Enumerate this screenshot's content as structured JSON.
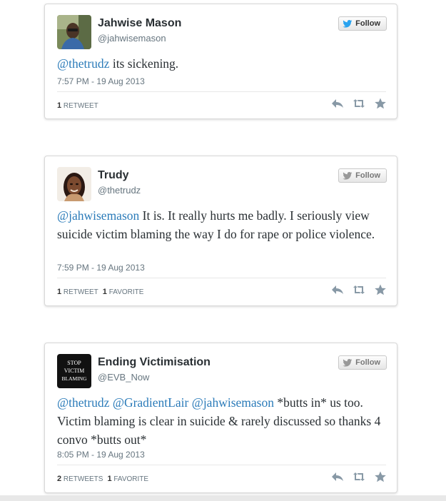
{
  "follow_label": "Follow",
  "tweets": [
    {
      "name": "Jahwise Mason",
      "handle": "@jahwisemason",
      "mention1": "@thetrudz",
      "mention2": "",
      "mention3": "",
      "body": "its sickening.",
      "timestamp": "7:57 PM - 19 Aug 2013",
      "retweet_count": "1",
      "retweet_label": "RETWEET",
      "favorite_count": "",
      "favorite_label": ""
    },
    {
      "name": "Trudy",
      "handle": "@thetrudz",
      "mention1": "@jahwisemason",
      "mention2": "",
      "mention3": "",
      "body": "It is. It really hurts me badly. I seriously view suicide victim blaming the way I do for rape or police violence.",
      "timestamp": "7:59 PM - 19 Aug 2013",
      "retweet_count": "1",
      "retweet_label": "RETWEET",
      "favorite_count": "1",
      "favorite_label": "FAVORITE"
    },
    {
      "name": "Ending Victimisation",
      "handle": "@EVB_Now",
      "mention1": "@thetrudz",
      "mention2": "@GradientLair",
      "mention3": "@jahwisemason",
      "body": "*butts in* us too. Victim blaming is clear in suicide & rarely discussed so thanks 4 convo *butts out*",
      "timestamp": "8:05 PM - 19 Aug 2013",
      "retweet_count": "2",
      "retweet_label": "RETWEETS",
      "favorite_count": "1",
      "favorite_label": "FAVORITE"
    }
  ],
  "avatar3_text": [
    "STOP",
    "VICTIM",
    "BLAMING"
  ],
  "colors": {
    "mention": "#2b7bb9",
    "name": "#292f33",
    "meta": "#66757f",
    "bird_active": "#2aa3ef",
    "bird_muted": "#999999"
  },
  "icons": [
    "twitter-bird-icon",
    "reply-icon",
    "retweet-icon",
    "favorite-star-icon"
  ]
}
